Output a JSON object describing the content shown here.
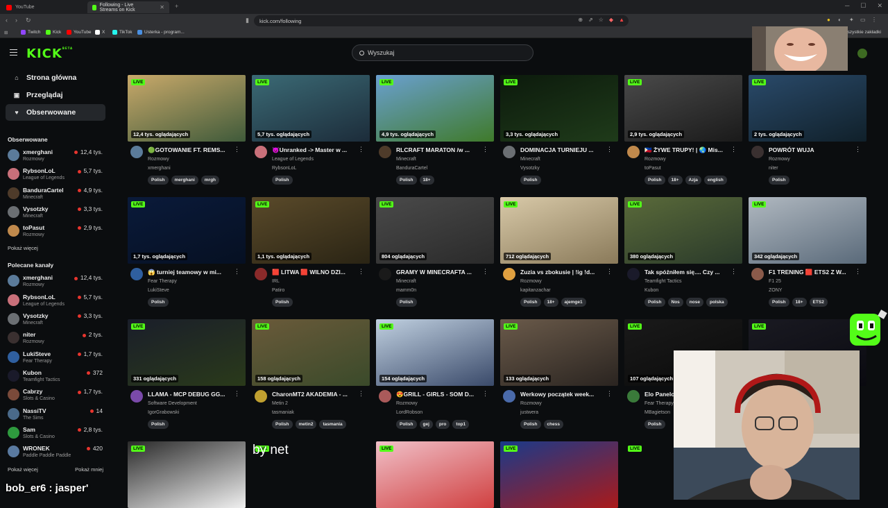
{
  "browser": {
    "tabs": [
      {
        "label": "YouTube",
        "active": false,
        "color": "#ff0000"
      },
      {
        "label": "Following - Live Streams on Kick",
        "active": true,
        "color": "#53fc18"
      }
    ],
    "url": "kick.com/following",
    "bookmarks": [
      {
        "label": "Twitch",
        "color": "#9146ff"
      },
      {
        "label": "Kick",
        "color": "#53fc18"
      },
      {
        "label": "YouTube",
        "color": "#ff0000"
      },
      {
        "label": "X",
        "color": "#ffffff"
      },
      {
        "label": "TikTok",
        "color": "#25f4ee"
      },
      {
        "label": "Usterka - program...",
        "color": "#4a90e2"
      }
    ],
    "all_bookmarks": "Wszystkie zakładki"
  },
  "kick": {
    "logo": "KICK",
    "logo_beta": "BETA",
    "accent": "#53fc18",
    "search_placeholder": "Wyszukaj"
  },
  "sidebar": {
    "nav": [
      {
        "label": "Strona główna",
        "icon": "home-icon",
        "glyph": "⌂"
      },
      {
        "label": "Przeglądaj",
        "icon": "browse-icon",
        "glyph": "▣"
      },
      {
        "label": "Obserwowane",
        "icon": "heart-icon",
        "glyph": "♥"
      }
    ],
    "followed_title": "Obserwowane",
    "followed": [
      {
        "name": "xmerghani",
        "category": "Rozmowy",
        "viewers": "12,4 tys.",
        "color": "#5b7b9a"
      },
      {
        "name": "RybsonLoL",
        "category": "League of Legends",
        "viewers": "5,7 tys.",
        "color": "#c9707a"
      },
      {
        "name": "BanduraCartel",
        "category": "Minecraft",
        "viewers": "4,9 tys.",
        "color": "#4e3b2a"
      },
      {
        "name": "Vysotzky",
        "category": "Minecraft",
        "viewers": "3,3 tys.",
        "color": "#6b6f73"
      },
      {
        "name": "toPasut",
        "category": "Rozmowy",
        "viewers": "2,9 tys.",
        "color": "#c0894c"
      }
    ],
    "show_more": "Pokaż więcej",
    "recommended_title": "Polecane kanały",
    "recommended": [
      {
        "name": "xmerghani",
        "category": "Rozmowy",
        "viewers": "12,4 tys.",
        "color": "#5b7b9a"
      },
      {
        "name": "RybsonLoL",
        "category": "League of Legends",
        "viewers": "5,7 tys.",
        "color": "#c9707a"
      },
      {
        "name": "Vysotzky",
        "category": "Minecraft",
        "viewers": "3,3 tys.",
        "color": "#6b6f73"
      },
      {
        "name": "niter",
        "category": "Rozmowy",
        "viewers": "2 tys.",
        "color": "#3a3030"
      },
      {
        "name": "LukiSteve",
        "category": "Fear Therapy",
        "viewers": "1,7 tys.",
        "color": "#2f5f9f"
      },
      {
        "name": "Kubon",
        "category": "Teamfight Tactics",
        "viewers": "372",
        "color": "#1a1a2a"
      },
      {
        "name": "Cabrzy",
        "category": "Slots & Casino",
        "viewers": "1,7 tys.",
        "color": "#7a4a3a"
      },
      {
        "name": "NassiTV",
        "category": "The Sims",
        "viewers": "14",
        "color": "#4a6a8a"
      },
      {
        "name": "Sam",
        "category": "Slots & Casino",
        "viewers": "2,8 tys.",
        "color": "#2e9a3e"
      },
      {
        "name": "WRONEK",
        "category": "Paddle Paddle Paddle",
        "viewers": "420",
        "color": "#5a7aa0"
      }
    ],
    "show_more2": "Pokaż więcej",
    "show_less": "Pokaż mniej"
  },
  "live_label": "LIVE",
  "streams": [
    {
      "viewers": "12,4 tys. oglądających",
      "title": "🟢GOTOWANIE FT. REMS...",
      "category": "Rozmowy",
      "user": "xmerghani",
      "tags": [
        "Polish",
        "merghani",
        "mrgh"
      ],
      "bg": [
        "#c9a96a",
        "#3f5a3a"
      ],
      "avatar": "#5b7b9a"
    },
    {
      "viewers": "5,7 tys. oglądających",
      "title": "😈Unranked -> Master w ...",
      "category": "League of Legends",
      "user": "RybsonLoL",
      "tags": [
        "Polish"
      ],
      "bg": [
        "#3b6a75",
        "#1c2c3a"
      ],
      "avatar": "#c9707a"
    },
    {
      "viewers": "4,9 tys. oglądających",
      "title": "RLCRAFT MARATON /w ...",
      "category": "Minecraft",
      "user": "BanduraCartel",
      "tags": [
        "Polish",
        "18+"
      ],
      "bg": [
        "#6aa0d0",
        "#3f7a2a"
      ],
      "avatar": "#4e3b2a"
    },
    {
      "viewers": "3,3 tys. oglądających",
      "title": "DOMINACJA TURNIEJU ...",
      "category": "Minecraft",
      "user": "Vysotzky",
      "tags": [
        "Polish"
      ],
      "bg": [
        "#0c1a0c",
        "#1f3b1a"
      ],
      "avatar": "#6b6f73"
    },
    {
      "viewers": "2,9 tys. oglądających",
      "title": "🇵🇭 ŻYWE TRUPY! | 🌏 Mis...",
      "category": "Rozmowy",
      "user": "toPasut",
      "tags": [
        "Polish",
        "18+",
        "Azja",
        "english"
      ],
      "bg": [
        "#4a4a4a",
        "#1a1a1a"
      ],
      "avatar": "#c0894c"
    },
    {
      "viewers": "2 tys. oglądających",
      "title": "POWRÓT WUJA",
      "category": "Rozmowy",
      "user": "niter",
      "tags": [
        "Polish"
      ],
      "bg": [
        "#2a4a6a",
        "#10202a"
      ],
      "avatar": "#3a3030"
    },
    {
      "viewers": "1,7 tys. oglądających",
      "title": "😱 turniej teamowy w mi...",
      "category": "Fear Therapy",
      "user": "LukiSteve",
      "tags": [
        "Polish"
      ],
      "bg": [
        "#0a1a3a",
        "#061022"
      ],
      "avatar": "#2f5f9f"
    },
    {
      "viewers": "1,1 tys. oglądających",
      "title": "🟥 LITWA 🟥 WILNO DZI...",
      "category": "IRL",
      "user": "Patiro",
      "tags": [
        "Polish"
      ],
      "bg": [
        "#5a4a2a",
        "#2a2414"
      ],
      "avatar": "#8a2a2a"
    },
    {
      "viewers": "804 oglądających",
      "title": "GRAMY W MINECRAFTA ...",
      "category": "Minecraft",
      "user": "mamm0n",
      "tags": [
        "Polish"
      ],
      "bg": [
        "#4a4a4a",
        "#2a2a2a"
      ],
      "avatar": "#1a1a1a"
    },
    {
      "viewers": "712 oglądających",
      "title": "Zuzia vs zbokusie | !ig !d...",
      "category": "Rozmowy",
      "user": "kapitanzachar",
      "tags": [
        "Polish",
        "18+",
        "ajemge1"
      ],
      "bg": [
        "#d8c9a8",
        "#8a7a5a"
      ],
      "avatar": "#e0a040"
    },
    {
      "viewers": "380 oglądających",
      "title": "Tak spóźniłem się.... Czy ...",
      "category": "Teamfight Tactics",
      "user": "Kubon",
      "tags": [
        "Polish",
        "Nos",
        "nose",
        "polska"
      ],
      "bg": [
        "#5a6a3a",
        "#2a3a2a"
      ],
      "avatar": "#1a1a2a"
    },
    {
      "viewers": "342 oglądających",
      "title": "F1 TRENING 🟥 ETS2 Z W...",
      "category": "F1 25",
      "user": "ZONY",
      "tags": [
        "Polish",
        "18+",
        "ETS2"
      ],
      "bg": [
        "#b0b8c0",
        "#5a6a7a"
      ],
      "avatar": "#8a5a4a"
    },
    {
      "viewers": "331 oglądających",
      "title": "LLAMA - MCP DEBUG GG...",
      "category": "Software Development",
      "user": "IgorGrabowski",
      "tags": [
        "Polish"
      ],
      "bg": [
        "#1a1e2a",
        "#2a3a1a"
      ],
      "avatar": "#7a4aaa"
    },
    {
      "viewers": "158 oglądających",
      "title": "CharonMT2 AKADEMIA - ...",
      "category": "Metin 2",
      "user": "tasmaniak",
      "tags": [
        "Polish",
        "metin2",
        "tasmania"
      ],
      "bg": [
        "#6a5a3a",
        "#3a4a2a"
      ],
      "avatar": "#c0a030"
    },
    {
      "viewers": "154 oglądających",
      "title": "😍GRILL - GIRLS - SOM D...",
      "category": "Rozmowy",
      "user": "LordRobson",
      "tags": [
        "Polish",
        "gej",
        "pro",
        "top1"
      ],
      "bg": [
        "#c0d0e0",
        "#3a4a6a"
      ],
      "avatar": "#aa5a5a"
    },
    {
      "viewers": "133 oglądających",
      "title": "Werkowy początek week...",
      "category": "Rozmowy",
      "user": "justwera",
      "tags": [
        "Polish",
        "chess"
      ],
      "bg": [
        "#6a5a4a",
        "#2a2420"
      ],
      "avatar": "#4a6aaa"
    },
    {
      "viewers": "107 oglądających",
      "title": "Elo Panelo",
      "category": "Fear Therapy",
      "user": "MBagietson",
      "tags": [
        "Polish"
      ],
      "bg": [
        "#1a1a1a",
        "#0a0a0a"
      ],
      "avatar": "#3a7a3a"
    },
    {
      "viewers": "",
      "title": "",
      "category": "",
      "user": "",
      "tags": [],
      "bg": [
        "#1a1a22",
        "#0a0a10"
      ],
      "avatar": ""
    },
    {
      "viewers": "",
      "title": "",
      "category": "",
      "user": "",
      "tags": [],
      "bg": [
        "#2a2a2a",
        "#f0f0f0"
      ],
      "avatar": ""
    },
    {
      "viewers": "",
      "title": "",
      "category": "",
      "user": "",
      "tags": [],
      "bg": [
        "#0b0d0f",
        "#0b0d0f"
      ],
      "avatar": ""
    },
    {
      "viewers": "",
      "title": "",
      "category": "",
      "user": "",
      "tags": [],
      "bg": [
        "#f0c0c8",
        "#d04040"
      ],
      "avatar": ""
    },
    {
      "viewers": "",
      "title": "",
      "category": "",
      "user": "",
      "tags": [],
      "bg": [
        "#1a3a8a",
        "#aa1a1a"
      ],
      "avatar": ""
    },
    {
      "viewers": "",
      "title": "",
      "category": "",
      "user": "",
      "tags": [],
      "bg": [
        "#0b0d0f",
        "#0b0d0f"
      ],
      "avatar": ""
    }
  ],
  "overlay": {
    "caption": "bob_er6 : jasper'",
    "watermark": "by net"
  }
}
